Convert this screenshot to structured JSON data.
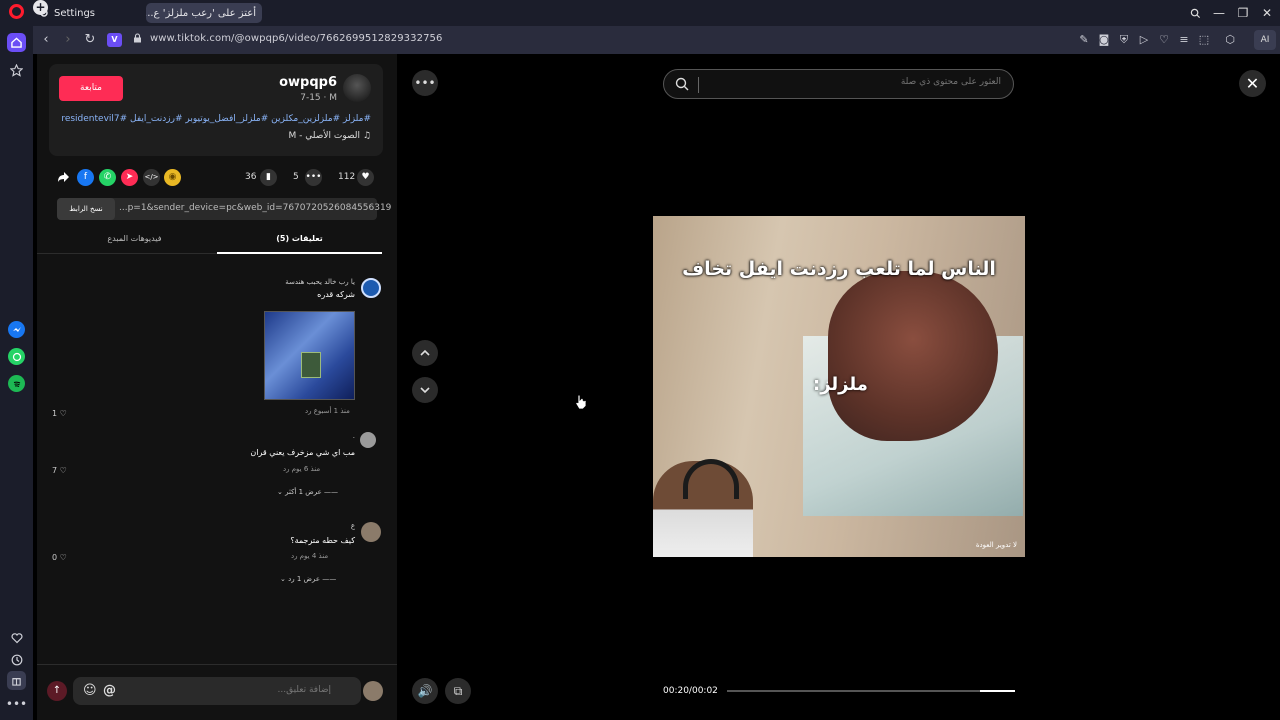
{
  "browser": {
    "tabs": [
      {
        "label": "Settings"
      },
      {
        "label": "أعتز على 'رعب ملزلز' ع..."
      }
    ],
    "url": "www.tiktok.com/@owpqp6/video/7662699512829332756",
    "vpn_label": "V",
    "ai_label": "AI"
  },
  "post": {
    "follow_label": "متابعة",
    "author": "owpqp6",
    "author_sub": "7-15 · M",
    "hashtags": "#ملزلز #ملزلزين_مكلزين #ملزلز_افضل_يوتيوبر #رزدنت_ايفل #residentevil7",
    "music": "الصوت الأصلي - M",
    "likes": "112",
    "comments_count": "5",
    "saves": "36",
    "copy_link_label": "نسخ الرابط",
    "share_url": "...p=1&sender_device=pc&web_id=7670720526084556319"
  },
  "panel_tabs": {
    "comments": "(5) تعليقات",
    "creator_videos": "فيديوهات المبدع"
  },
  "comments": [
    {
      "user": "يا رب خالد يحبب هندسة",
      "text": "شركه قدره",
      "meta": "منذ 1 أسبوع   رد",
      "likes": "1"
    },
    {
      "user": ".",
      "text": "مب اي شي مزخرف يعني قران",
      "meta": "منذ 6 يوم   رد",
      "likes": "7",
      "more": "عرض 1 أكثر"
    },
    {
      "user": "ع",
      "text": "كيف حطه مترجمة؟",
      "meta": "منذ 4 يوم   رد",
      "likes": "0",
      "more": "عرض 1 رد"
    }
  ],
  "input": {
    "placeholder": "إضافة تعليق..."
  },
  "video": {
    "search_placeholder": "العثور على محتوى ذي صلة",
    "caption_main": "الناس لما تلعب رزدنت ايفل تخاف",
    "caption_sub": "ملزلز:",
    "watermark": "لا   تدوير   العودة",
    "time": "00:20/00:02",
    "progress": 0.88
  },
  "colors": {
    "accent": "#fe2c55",
    "opera_red": "#ff1b2d",
    "opera_purple": "#6b4ef5"
  }
}
